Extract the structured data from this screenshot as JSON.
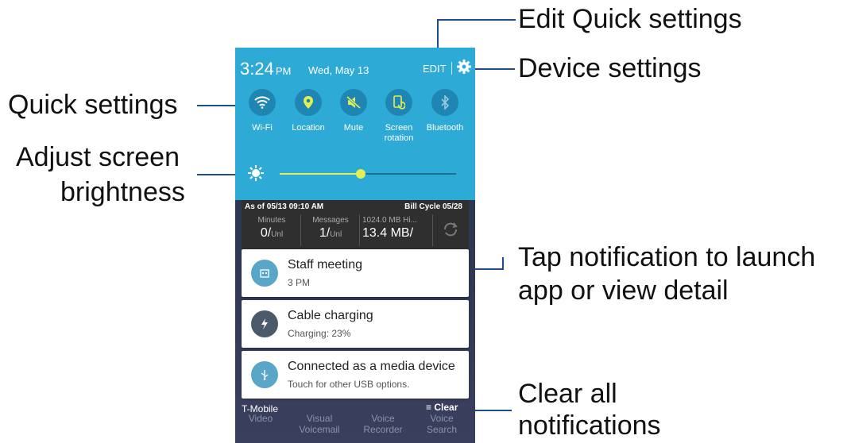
{
  "callouts": {
    "edit_quick_settings": "Edit Quick settings",
    "device_settings": "Device settings",
    "quick_settings": "Quick settings",
    "adjust_brightness_line1": "Adjust screen",
    "adjust_brightness_line2": "brightness",
    "tap_notification_line1": "Tap notification to launch",
    "tap_notification_line2": "app or view detail",
    "clear_all_line1": "Clear all",
    "clear_all_line2": "notifications"
  },
  "status": {
    "time": "3:24",
    "ampm": "PM",
    "date": "Wed, May 13",
    "edit": "EDIT"
  },
  "quick_tiles": [
    {
      "label": "Wi-Fi",
      "icon": "wifi-icon"
    },
    {
      "label": "Location",
      "icon": "location-icon"
    },
    {
      "label": "Mute",
      "icon": "mute-icon"
    },
    {
      "label": "Screen rotation",
      "icon": "screen-rotation-icon"
    },
    {
      "label": "Bluetooth",
      "icon": "bluetooth-icon"
    }
  ],
  "brightness": {
    "level": 0.46
  },
  "data_widget": {
    "as_of": "As of  05/13 09:10 AM",
    "bill_cycle": "Bill Cycle 05/28",
    "minutes_label": "Minutes",
    "minutes_value": "0/",
    "minutes_unit": "Unl",
    "messages_label": "Messages",
    "messages_value": "1/",
    "messages_unit": "Unl",
    "data_label": "1024.0 MB Hi...",
    "data_value": "13.4 MB/"
  },
  "notifications": [
    {
      "title": "Staff meeting",
      "subtitle": "3 PM",
      "icon": "calendar-icon",
      "color": "#5aa6c8"
    },
    {
      "title": "Cable charging",
      "subtitle": "Charging: 23%",
      "icon": "lightning-icon",
      "color": "#4a5a6b"
    },
    {
      "title": "Connected as a media device",
      "subtitle": "Touch for other USB options.",
      "icon": "usb-icon",
      "color": "#5aa6c8"
    }
  ],
  "footer": {
    "carrier": "T-Mobile",
    "clear": "Clear"
  },
  "background_apps": [
    "Video",
    "Visual Voicemail",
    "Voice Recorder",
    "Voice Search"
  ],
  "colors": {
    "panel": "#2dabd6",
    "tile": "#1f86b4",
    "accent": "#e3ef52",
    "line": "#1b4f8f"
  }
}
